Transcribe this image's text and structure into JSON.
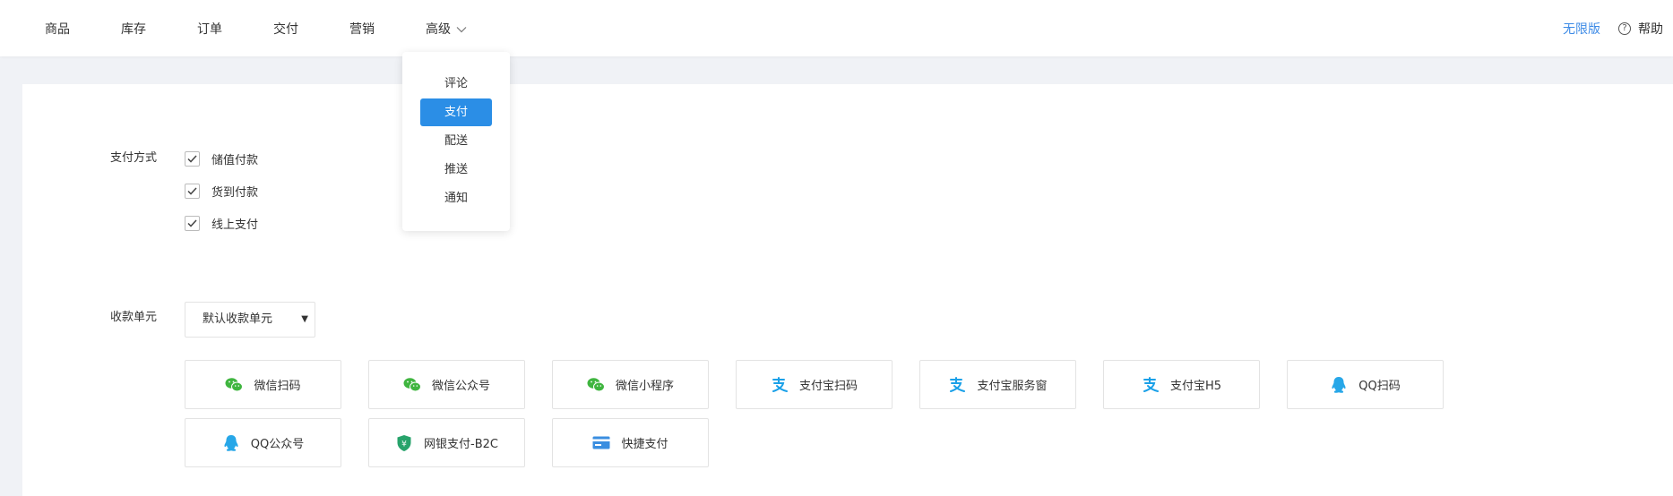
{
  "nav": {
    "items": [
      {
        "label": "商品"
      },
      {
        "label": "库存"
      },
      {
        "label": "订单"
      },
      {
        "label": "交付"
      },
      {
        "label": "营销"
      },
      {
        "label": "高级"
      }
    ]
  },
  "top_right": {
    "edition": "无限版",
    "help_label": "帮助"
  },
  "dropdown": {
    "items": [
      {
        "label": "评论",
        "active": false
      },
      {
        "label": "支付",
        "active": true
      },
      {
        "label": "配送",
        "active": false
      },
      {
        "label": "推送",
        "active": false
      },
      {
        "label": "通知",
        "active": false
      }
    ]
  },
  "form": {
    "payment_method_label": "支付方式",
    "payment_methods": [
      {
        "label": "储值付款",
        "checked": true
      },
      {
        "label": "货到付款",
        "checked": true
      },
      {
        "label": "线上支付",
        "checked": true
      }
    ],
    "collection_unit_label": "收款单元",
    "collection_unit_value": "默认收款单元"
  },
  "pay_channels": [
    {
      "label": "微信扫码",
      "icon": "wechat-icon"
    },
    {
      "label": "微信公众号",
      "icon": "wechat-icon"
    },
    {
      "label": "微信小程序",
      "icon": "wechat-icon"
    },
    {
      "label": "支付宝扫码",
      "icon": "alipay-icon"
    },
    {
      "label": "支付宝服务窗",
      "icon": "alipay-icon"
    },
    {
      "label": "支付宝H5",
      "icon": "alipay-icon"
    },
    {
      "label": "QQ扫码",
      "icon": "qq-icon"
    },
    {
      "label": "QQ公众号",
      "icon": "qq-icon"
    },
    {
      "label": "网银支付-B2C",
      "icon": "bank-shield-icon"
    },
    {
      "label": "快捷支付",
      "icon": "card-icon"
    }
  ],
  "colors": {
    "accent": "#2b8ee6",
    "edition": "#3c8ae6",
    "wechat": "#3fb53f",
    "alipay": "#1aa0e8",
    "qq": "#27a7e8",
    "bank": "#27a36b"
  }
}
